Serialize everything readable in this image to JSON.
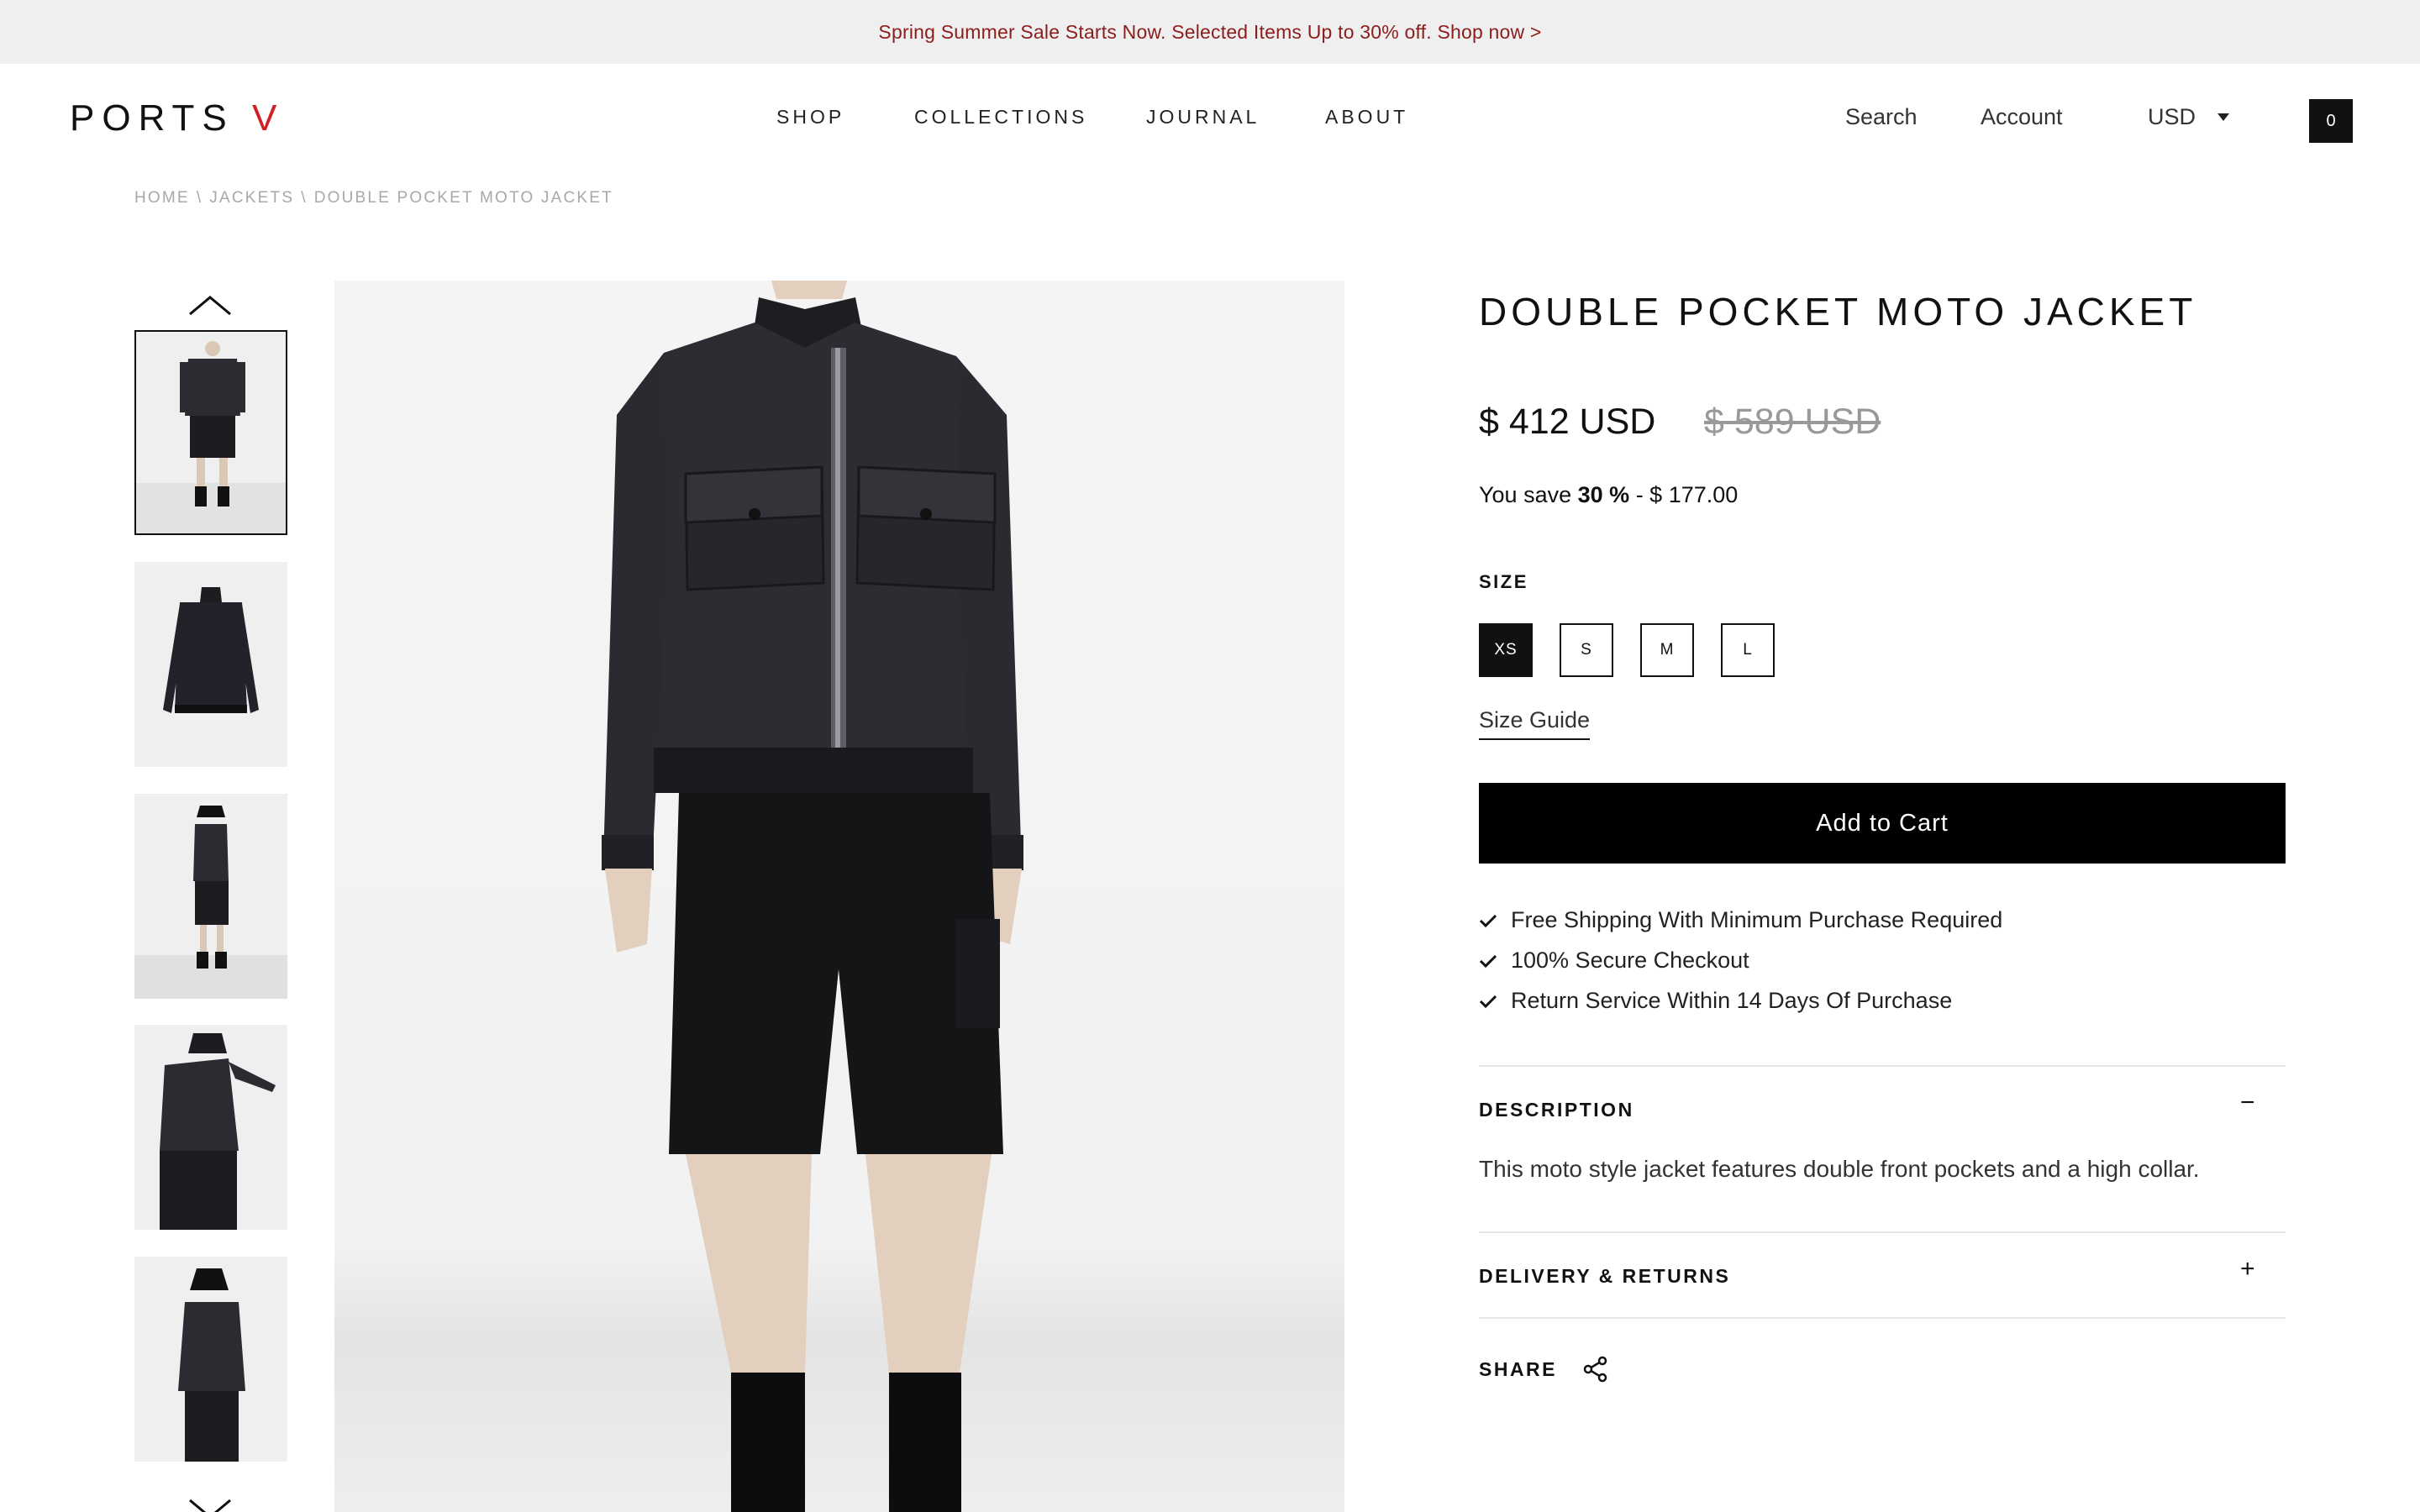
{
  "announcement": "Spring Summer Sale Starts Now. Selected Items Up to 30% off. Shop now >",
  "logo": {
    "text": "PORTS",
    "accent": "V",
    "accent_color": "#d21f26"
  },
  "nav": {
    "shop": "SHOP",
    "collections": "COLLECTIONS",
    "journal": "JOURNAL",
    "about": "ABOUT"
  },
  "header": {
    "search": "Search",
    "account": "Account",
    "currency": "USD",
    "cart_count": "0"
  },
  "breadcrumb": {
    "home": "HOME",
    "sep": "\\",
    "category": "JACKETS",
    "current": "DOUBLE POCKET MOTO JACKET"
  },
  "product": {
    "title": "DOUBLE POCKET MOTO JACKET",
    "price": "$ 412 USD",
    "original_price": "$ 589 USD",
    "save_prefix": "You save",
    "save_percent": "30 %",
    "save_suffix": "- $ 177.00",
    "size_label": "SIZE",
    "sizes": [
      "XS",
      "S",
      "M",
      "L"
    ],
    "selected_size": "XS",
    "size_guide": "Size Guide",
    "add_to_cart": "Add to Cart",
    "perks": [
      "Free Shipping With Minimum Purchase Required",
      "100% Secure Checkout",
      "Return Service Within 14 Days Of Purchase"
    ],
    "description_heading": "DESCRIPTION",
    "description_icon": "−",
    "description": "This moto style jacket features double front pockets and a high collar.",
    "delivery_heading": "DELIVERY & RETURNS",
    "delivery_icon": "+",
    "share": "SHARE"
  },
  "gallery": {
    "thumb_count": 5,
    "selected_thumb": 1,
    "garment_color": "#2b2b31"
  }
}
